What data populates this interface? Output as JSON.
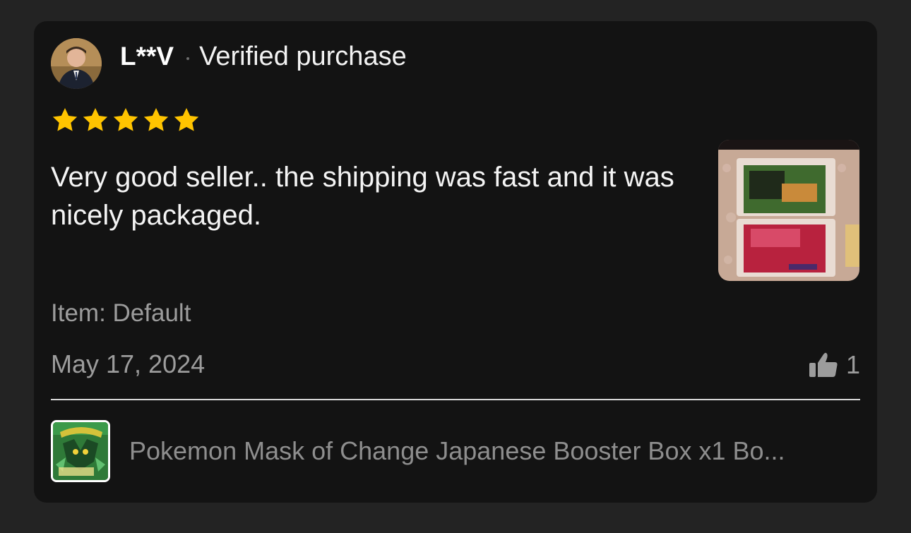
{
  "review": {
    "username": "L**V",
    "verified_label": "Verified purchase",
    "rating": 5,
    "rating_max": 5,
    "star_color": "#FFC400",
    "text": "Very good seller.. the shipping was fast and it was nicely packaged.",
    "item_label": "Item: Default",
    "date": "May 17, 2024",
    "helpful_count": "1",
    "helpful_icon": "thumbs-up-icon"
  },
  "product": {
    "title": "Pokemon Mask of Change Japanese Booster Box x1 Bo..."
  },
  "colors": {
    "page_background": "#232323",
    "card_background": "#131313",
    "primary_text": "#F4F4F4",
    "secondary_text": "#9C9C9C"
  }
}
